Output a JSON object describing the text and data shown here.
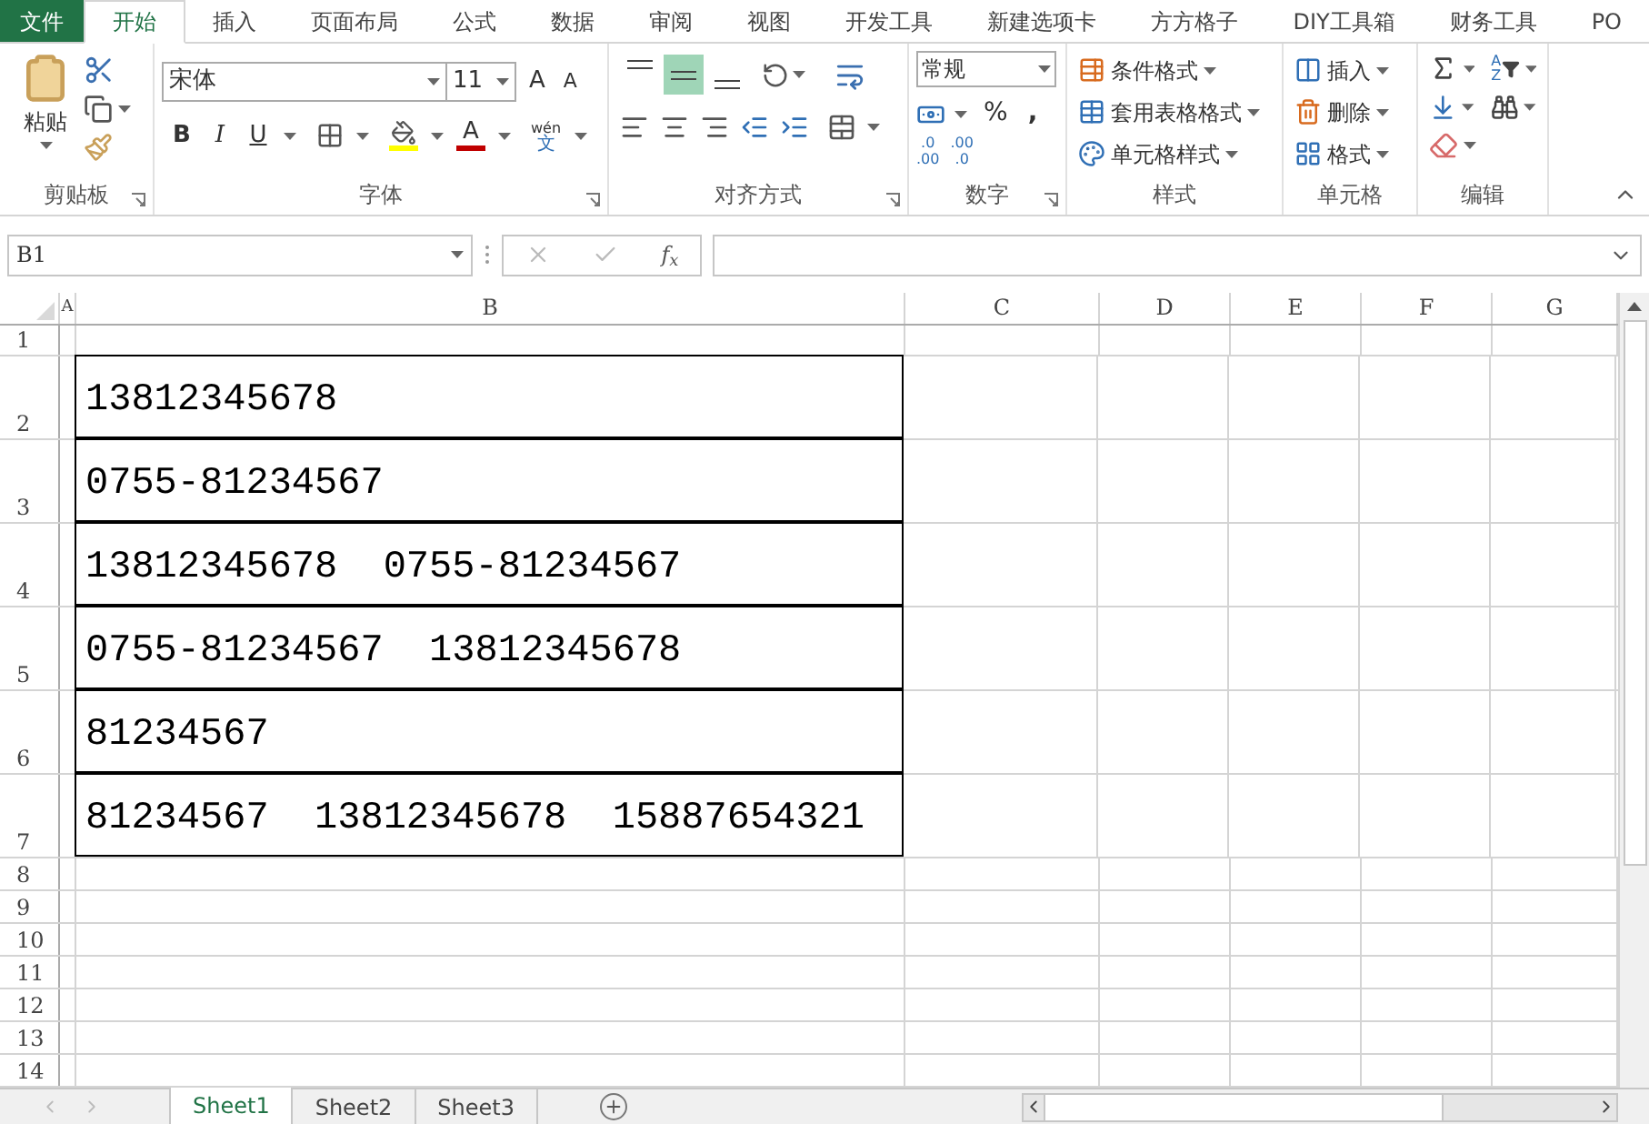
{
  "tabs": [
    {
      "label": "文件",
      "kind": "file",
      "selected": false
    },
    {
      "label": "开始",
      "kind": "tab",
      "selected": true
    },
    {
      "label": "插入",
      "kind": "tab",
      "selected": false
    },
    {
      "label": "页面布局",
      "kind": "tab",
      "selected": false
    },
    {
      "label": "公式",
      "kind": "tab",
      "selected": false
    },
    {
      "label": "数据",
      "kind": "tab",
      "selected": false
    },
    {
      "label": "审阅",
      "kind": "tab",
      "selected": false
    },
    {
      "label": "视图",
      "kind": "tab",
      "selected": false
    },
    {
      "label": "开发工具",
      "kind": "tab",
      "selected": false
    },
    {
      "label": "新建选项卡",
      "kind": "tab",
      "selected": false
    },
    {
      "label": "方方格子",
      "kind": "tab",
      "selected": false
    },
    {
      "label": "DIY工具箱",
      "kind": "tab",
      "selected": false
    },
    {
      "label": "财务工具",
      "kind": "tab",
      "selected": false
    },
    {
      "label": "PO",
      "kind": "tab",
      "selected": false
    }
  ],
  "ribbon": {
    "clipboard": {
      "paste": "粘贴",
      "label": "剪贴板"
    },
    "font": {
      "font_name": "宋体",
      "font_size": "11",
      "bold": "B",
      "italic": "I",
      "underline": "U",
      "font_color_letter": "A",
      "phonetic": [
        "wén",
        "文"
      ],
      "grow_letter": "A",
      "shrink_letter": "A",
      "label": "字体"
    },
    "alignment": {
      "vertical": [
        {
          "selected": false
        },
        {
          "selected": true
        },
        {
          "selected": false
        }
      ],
      "label": "对齐方式"
    },
    "number": {
      "format": "常规",
      "percent": "%",
      "comma": ",",
      "increase_decimal": [
        ".0",
        ".00"
      ],
      "decrease_decimal": [
        ".00",
        ".0"
      ],
      "label": "数字"
    },
    "styles": {
      "items": [
        "条件格式",
        "套用表格格式",
        "单元格样式"
      ],
      "label": "样式"
    },
    "cells": {
      "items": [
        "插入",
        "删除",
        "格式"
      ],
      "label": "单元格"
    },
    "editing": {
      "sort_letters": [
        "A",
        "Z"
      ],
      "label": "编辑"
    }
  },
  "formula_bar": {
    "name_box": "B1",
    "fx": "f$_{x}$"
  },
  "sheet": {
    "columns": [
      "A",
      "B",
      "C",
      "D",
      "E",
      "F",
      "G"
    ],
    "rows": [
      {
        "header": "1"
      },
      {
        "header": "2",
        "value": "13812345678"
      },
      {
        "header": "3",
        "value": "0755-81234567"
      },
      {
        "header": "4",
        "value": "13812345678  0755-81234567"
      },
      {
        "header": "5",
        "value": "0755-81234567  13812345678"
      },
      {
        "header": "6",
        "value": "81234567"
      },
      {
        "header": "7",
        "value": "81234567  13812345678  15887654321"
      },
      {
        "header": "8"
      },
      {
        "header": "9"
      },
      {
        "header": "10"
      },
      {
        "header": "11"
      },
      {
        "header": "12"
      },
      {
        "header": "13"
      },
      {
        "header": "14"
      }
    ]
  },
  "sheet_tabs": [
    {
      "label": "Sheet1",
      "selected": true
    },
    {
      "label": "Sheet2",
      "selected": false
    },
    {
      "label": "Sheet3",
      "selected": false
    }
  ]
}
